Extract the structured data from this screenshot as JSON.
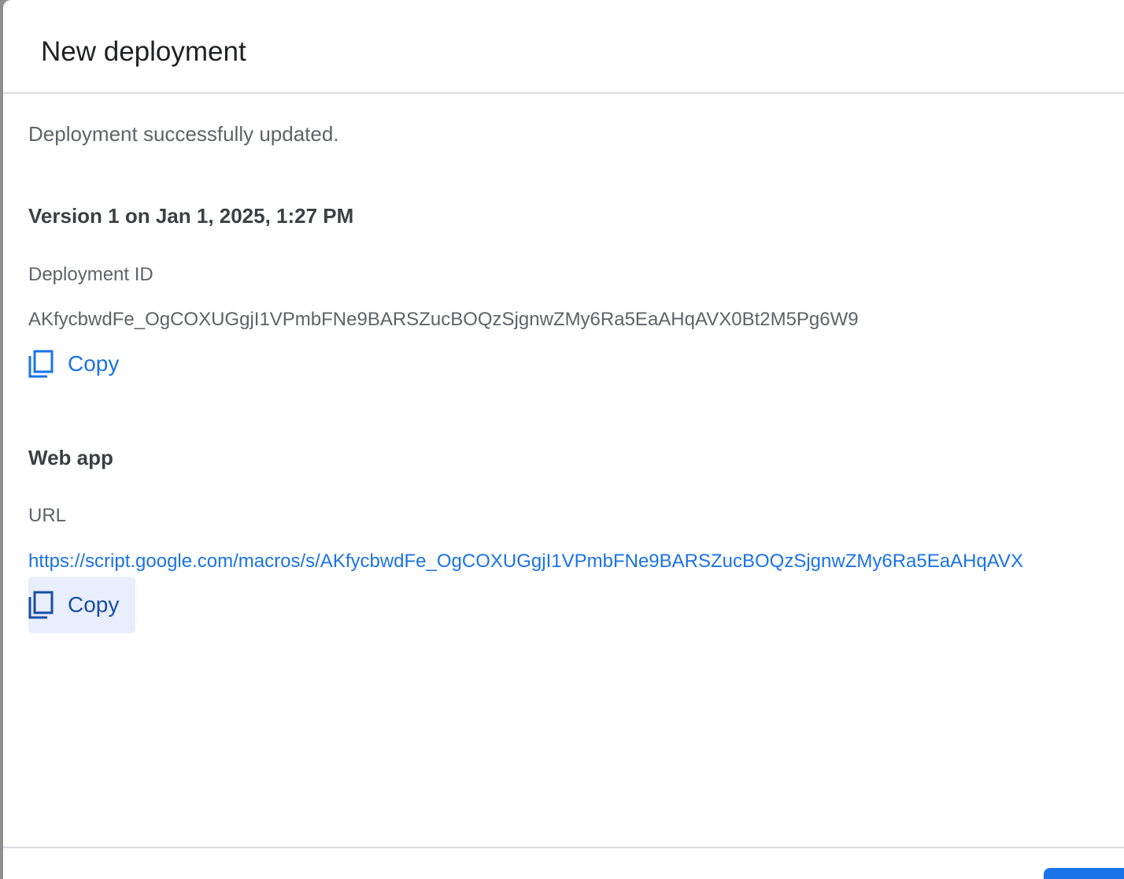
{
  "dialog": {
    "title": "New deployment"
  },
  "status": "Deployment successfully updated.",
  "version": {
    "heading": "Version 1 on Jan 1, 2025, 1:27 PM",
    "deployment_id_label": "Deployment ID",
    "deployment_id_value": "AKfycbwdFe_OgCOXUGgjI1VPmbFNe9BARSZucBOQzSjgnwZMy6Ra5EaAHqAVX0Bt2M5Pg6W9",
    "copy_label": "Copy"
  },
  "web_app": {
    "heading": "Web app",
    "url_label": "URL",
    "url_value": "https://script.google.com/macros/s/AKfycbwdFe_OgCOXUGgjI1VPmbFNe9BARSZucBOQzSjgnwZMy6Ra5EaAHqAVX",
    "copy_label": "Copy"
  },
  "colors": {
    "accent": "#1a73e8",
    "focused_button_bg": "#e8eefb",
    "divider": "#dadce0"
  },
  "icons": {
    "copy": "copy-icon"
  }
}
